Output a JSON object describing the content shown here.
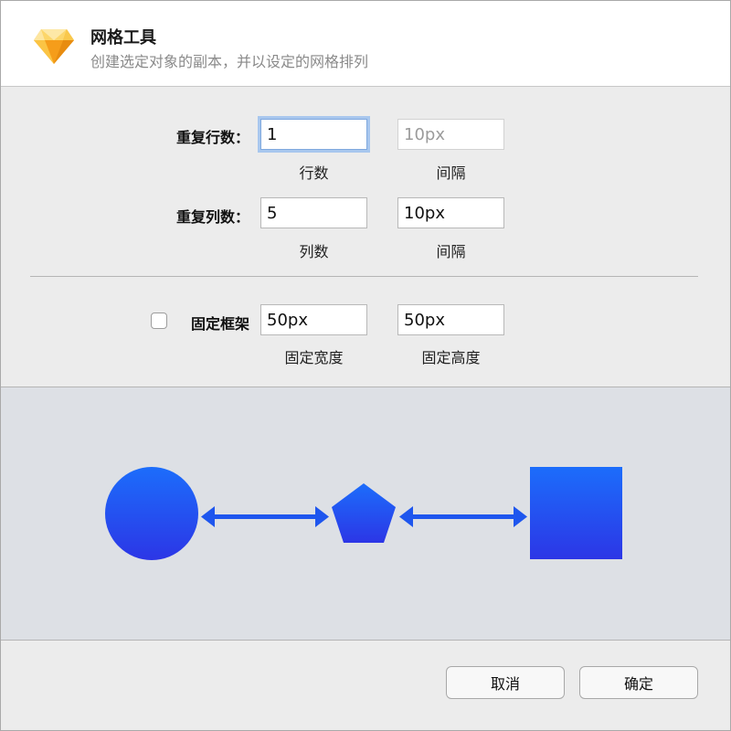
{
  "dialog": {
    "title": "网格工具",
    "subtitle": "创建选定对象的副本，并以设定的网格排列",
    "icon": "sketch-diamond-icon"
  },
  "rows": {
    "label": "重复行数：",
    "value": "1",
    "caption": "行数",
    "spacing_value": "10px",
    "spacing_caption": "间隔"
  },
  "columns": {
    "label": "重复列数：",
    "value": "5",
    "caption": "列数",
    "spacing_value": "10px",
    "spacing_caption": "间隔"
  },
  "fixed_frame": {
    "label": "固定框架",
    "checked": false,
    "width_value": "50px",
    "width_caption": "固定宽度",
    "height_value": "50px",
    "height_caption": "固定高度"
  },
  "preview": {
    "shapes": [
      "circle",
      "pentagon",
      "square"
    ],
    "shape_color_top": "#1c6dfb",
    "shape_color_bottom": "#2c36e6",
    "arrow_color": "#1e56ee"
  },
  "buttons": {
    "cancel": "取消",
    "confirm": "确定"
  }
}
